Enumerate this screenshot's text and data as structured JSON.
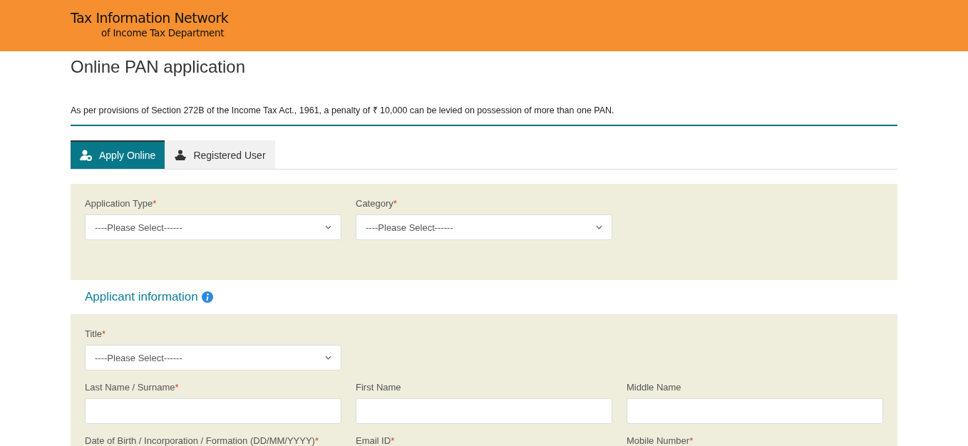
{
  "header": {
    "title": "Tax Information Network",
    "subtitle": "of Income Tax Department"
  },
  "page_title": "Online PAN application",
  "notice": "As per provisions of Section 272B of the Income Tax Act., 1961, a penalty of ₹ 10,000 can be levied on possession of more than one PAN.",
  "tabs": [
    {
      "label": "Apply Online",
      "selected": true
    },
    {
      "label": "Registered User",
      "selected": false
    }
  ],
  "application_panel": {
    "rows": [
      [
        {
          "label": "Application Type",
          "required_mark": "*",
          "kind": "select",
          "placeholder": "----Please Select------"
        },
        {
          "label": "Category",
          "required_mark": "*",
          "kind": "select",
          "placeholder": "----Please Select------"
        }
      ]
    ]
  },
  "applicant_section": {
    "title": "Applicant information"
  },
  "applicant_panel": {
    "rows": [
      [
        {
          "label": "Title",
          "required_mark": "*",
          "kind": "select",
          "placeholder": "----Please Select------"
        }
      ],
      [
        {
          "label": "Last Name / Surname",
          "required_mark": "*",
          "kind": "text"
        },
        {
          "label": "First Name",
          "kind": "text"
        },
        {
          "label": "Middle Name",
          "kind": "text"
        }
      ],
      [
        {
          "label": "Date of Birth / Incorporation / Formation (DD/MM/YYYY)",
          "required_mark": "*"
        },
        {
          "label": "Email ID",
          "required_mark": "*"
        },
        {
          "label": "Mobile Number",
          "required_mark": "*"
        }
      ]
    ]
  }
}
